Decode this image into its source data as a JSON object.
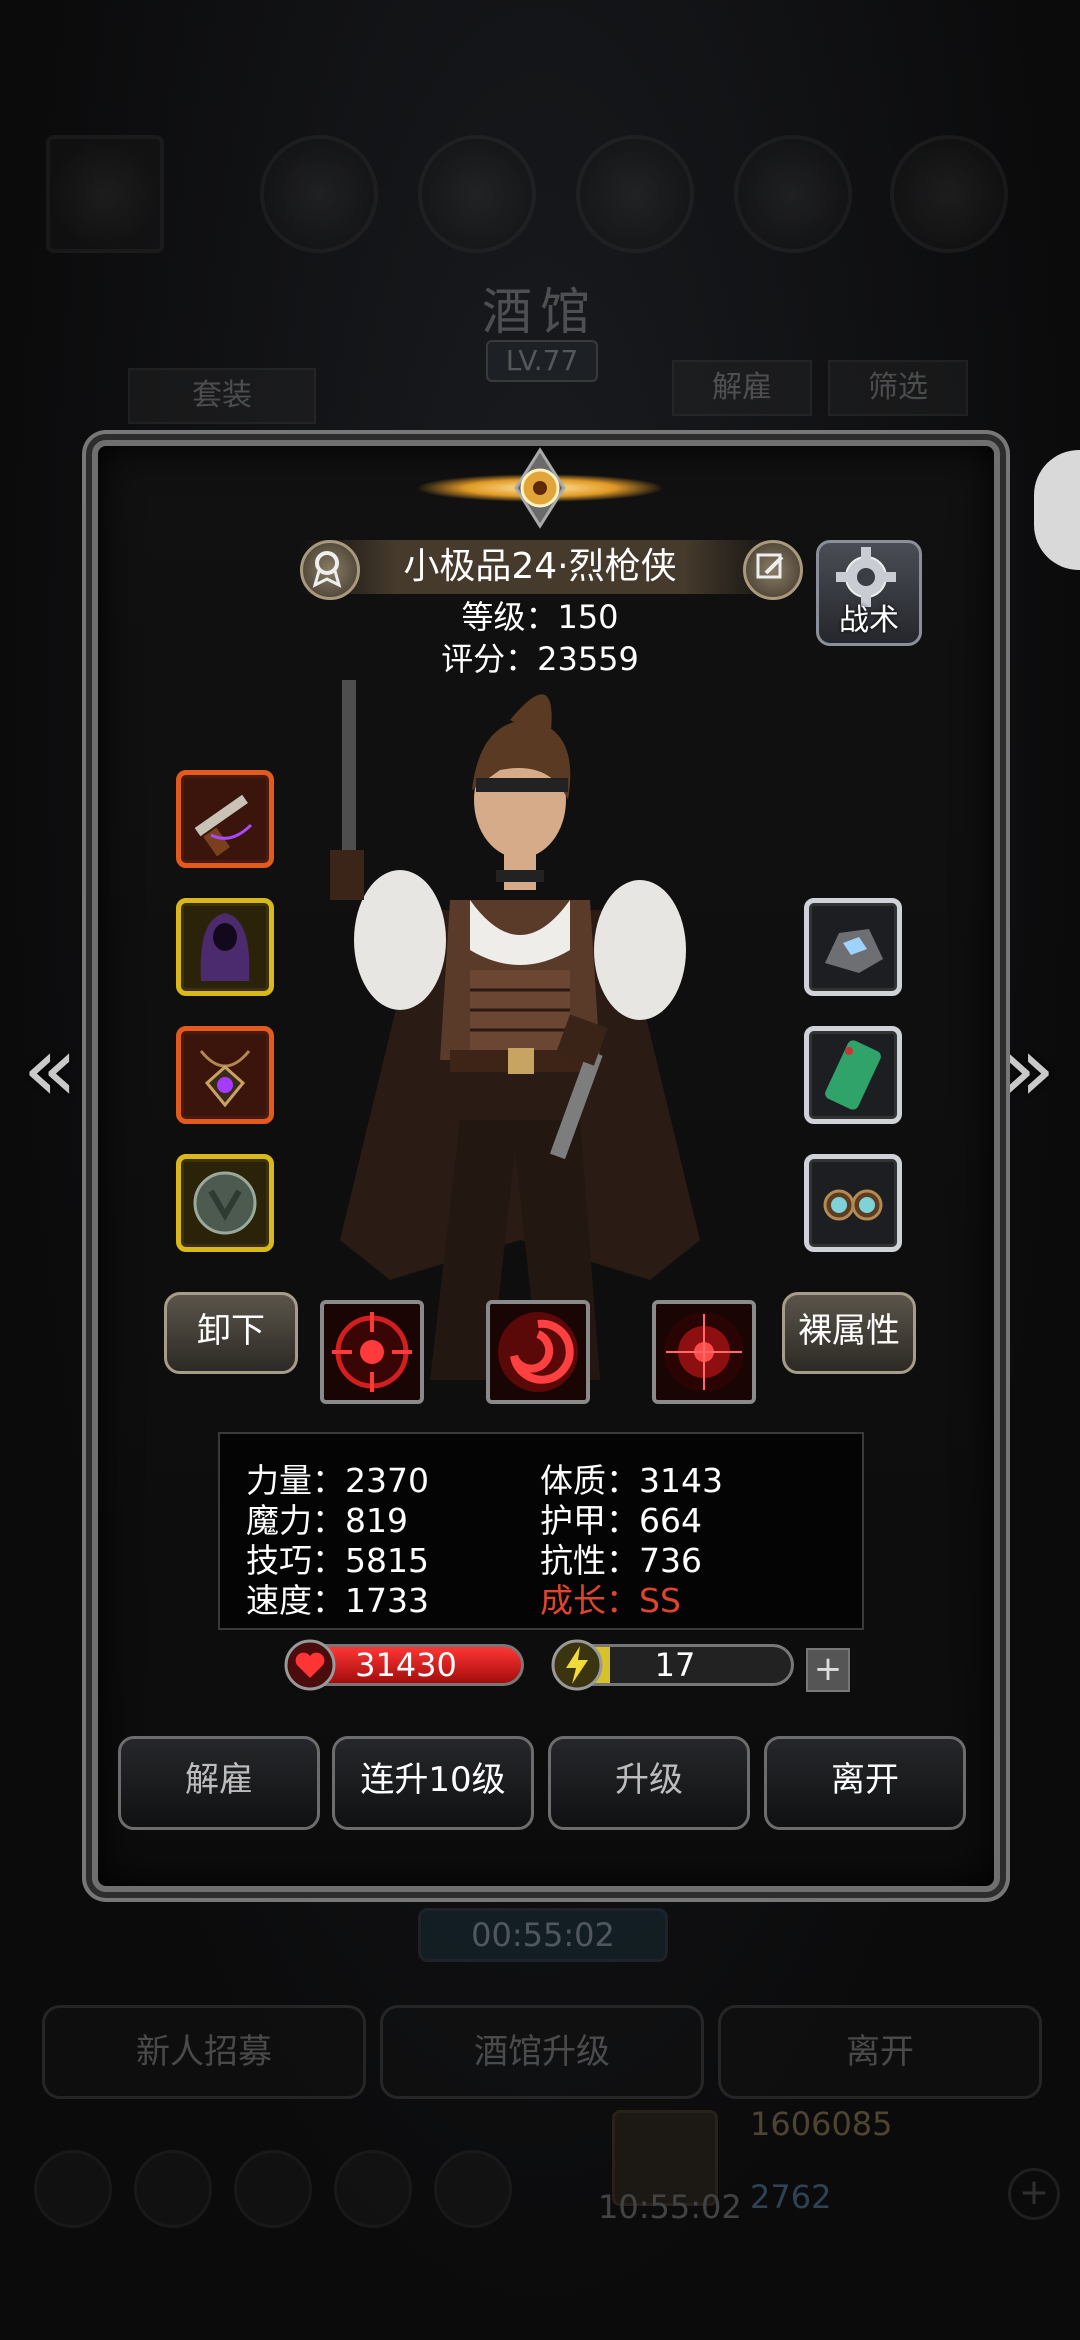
{
  "background": {
    "title": "酒馆",
    "level": "LV.77",
    "set_button": "套装",
    "dismiss_button": "解雇",
    "filter_button": "筛选",
    "timer": "00:55:02",
    "recruit_button": "新人招募",
    "upgrade_tavern_button": "酒馆升级",
    "leave_button": "离开",
    "gold": "1606085",
    "gems": "2762",
    "clock": "10:55:02"
  },
  "hero": {
    "name": "小极品24·烈枪侠",
    "level_text": "等级：150",
    "score_text": "评分：23559",
    "tactics_label": "战术"
  },
  "skill_row": {
    "unequip_label": "卸下",
    "base_attr_label": "裸属性"
  },
  "stats": {
    "strength": "力量：2370",
    "magic": "魔力：819",
    "skill": "技巧：5815",
    "speed": "速度：1733",
    "constitution": "体质：3143",
    "armor": "护甲：664",
    "resistance": "抗性：736",
    "growth_label": "成长：",
    "growth_value": "SS"
  },
  "bars": {
    "hp": "31430",
    "energy": "17",
    "energy_fraction": 0.22,
    "plus_label": "+"
  },
  "actions": {
    "dismiss": "解雇",
    "level_up_10": "连升10级",
    "level_up": "升级",
    "leave": "离开"
  },
  "colors": {
    "growth": "#e0442c",
    "hp": "#e01c1c",
    "energy": "#d8c12a",
    "slot_red": "#e35a1e",
    "slot_yellow": "#d9b81c"
  },
  "icons": {
    "left_slots": [
      "pistol-icon",
      "hooded-cloak-icon",
      "amulet-icon",
      "shield-emblem-icon"
    ],
    "right_slots": [
      "gemstone-icon",
      "jade-tablet-icon",
      "goggles-icon"
    ],
    "skills": [
      "target-icon",
      "vortex-icon",
      "crosshair-icon"
    ]
  }
}
